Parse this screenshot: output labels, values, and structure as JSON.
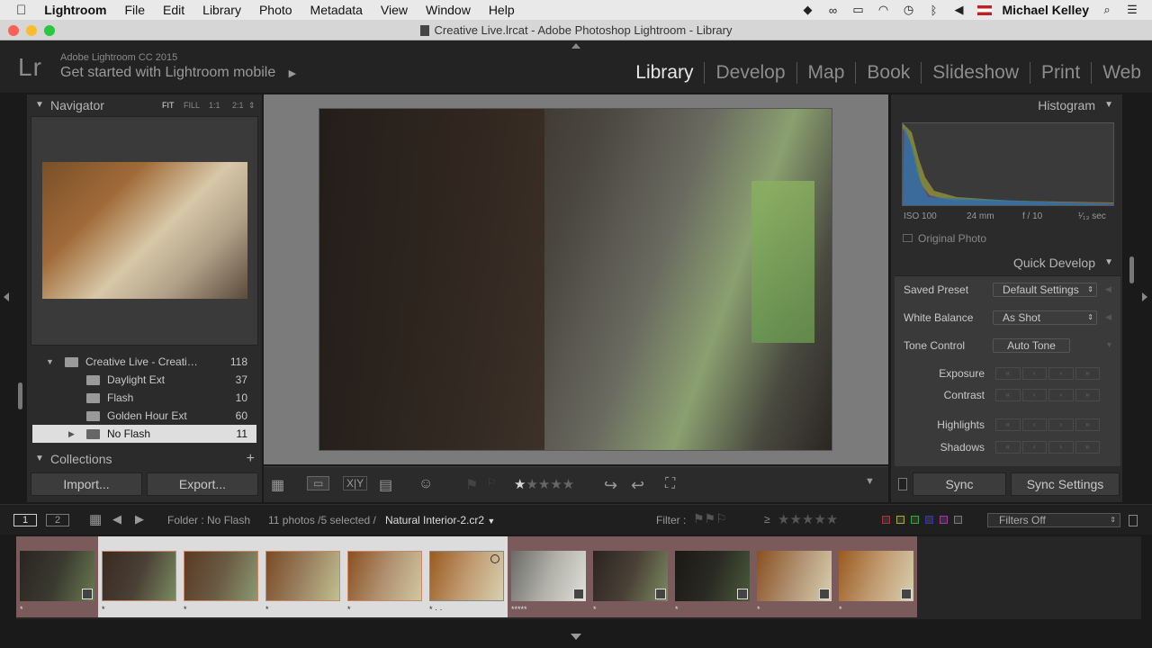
{
  "menubar": {
    "apple": "",
    "app": "Lightroom",
    "items": [
      "File",
      "Edit",
      "Library",
      "Photo",
      "Metadata",
      "View",
      "Window",
      "Help"
    ],
    "user": "Michael Kelley"
  },
  "titlebar": {
    "title": "Creative Live.lrcat - Adobe Photoshop Lightroom - Library"
  },
  "identity": {
    "logo": "Lr",
    "version": "Adobe Lightroom CC 2015",
    "mobile": "Get started with Lightroom mobile",
    "mobile_arrow": "▶",
    "modules": [
      "Library",
      "Develop",
      "Map",
      "Book",
      "Slideshow",
      "Print",
      "Web"
    ]
  },
  "navigator": {
    "title": "Navigator",
    "zoom": [
      "FIT",
      "FILL",
      "1:1",
      "2:1"
    ]
  },
  "folders": [
    {
      "name": "Creative Live - Creati…",
      "count": "118"
    },
    {
      "name": "Daylight Ext",
      "count": "37"
    },
    {
      "name": "Flash",
      "count": "10"
    },
    {
      "name": "Golden Hour Ext",
      "count": "60"
    },
    {
      "name": "No Flash",
      "count": "11"
    }
  ],
  "collections": {
    "title": "Collections",
    "add": "+"
  },
  "left_buttons": {
    "import": "Import...",
    "export": "Export..."
  },
  "histogram": {
    "title": "Histogram",
    "iso": "ISO 100",
    "focal": "24 mm",
    "aperture": "f / 10",
    "shutter": "¹⁄₁₃ sec",
    "original_photo": "Original Photo"
  },
  "quick_develop": {
    "title": "Quick Develop",
    "saved_preset_label": "Saved Preset",
    "saved_preset_value": "Default Settings",
    "white_balance_label": "White Balance",
    "white_balance_value": "As Shot",
    "tone_control_label": "Tone Control",
    "auto_tone": "Auto Tone",
    "rows": [
      "Exposure",
      "Contrast",
      "Highlights",
      "Shadows"
    ]
  },
  "right_buttons": {
    "sync": "Sync",
    "sync_settings": "Sync Settings"
  },
  "filmbar": {
    "page1": "1",
    "page2": "2",
    "folder": "Folder : No Flash",
    "count": "11 photos /5 selected /",
    "filename": "Natural Interior-2.cr2",
    "filter_label": "Filter :",
    "filter_value": "Filters Off",
    "gte": "≥"
  },
  "toolbar": {
    "rating": "★★★★★"
  },
  "thumbs": [
    {
      "stars": "*",
      "selected": false
    },
    {
      "stars": "*",
      "selected": true
    },
    {
      "stars": "*",
      "selected": true
    },
    {
      "stars": "*",
      "selected": true
    },
    {
      "stars": "*",
      "selected": true
    },
    {
      "stars": "* · ·",
      "selected": true
    },
    {
      "stars": "*****",
      "selected": false
    },
    {
      "stars": "*",
      "selected": false
    },
    {
      "stars": "*",
      "selected": false
    },
    {
      "stars": "*",
      "selected": false
    },
    {
      "stars": "*",
      "selected": false
    }
  ],
  "colors": {
    "accent": "#e6e6e6",
    "panel": "#2b2b2b",
    "center": "#7b7b7b",
    "film_unselected": "#7a5a5a"
  }
}
